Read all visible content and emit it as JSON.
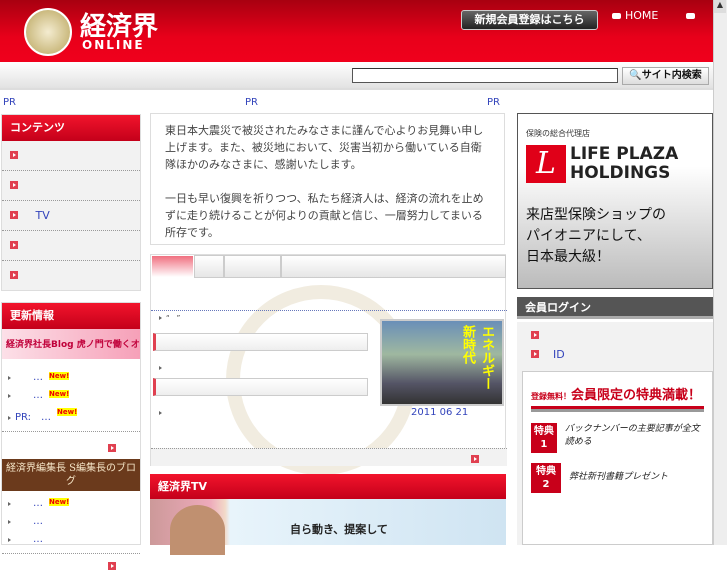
{
  "header": {
    "logo_title": "経済界",
    "logo_sub": "ONLINE",
    "register_button": "新規会員登録はこちら",
    "home_link": "HOME"
  },
  "search": {
    "placeholder": "",
    "button": "サイト内検索"
  },
  "pr_labels": [
    "PR",
    "PR",
    "PR"
  ],
  "sidebar": {
    "contents_title": "コンテンツ",
    "contents_items": [
      "",
      "",
      "TV",
      "",
      ""
    ],
    "updates_title": "更新情報",
    "blog1_banner": "経済界社長Blog 虎ノ門で働くオンナ社長",
    "blog1_items": [
      {
        "label": "…",
        "new": "New!"
      },
      {
        "label": "…",
        "new": "New!"
      },
      {
        "label": "PR:　…",
        "new": "New!"
      }
    ],
    "blog2_banner": "経済界編集長 S編集長のブログ",
    "blog2_items": [
      {
        "label": "…",
        "new": "New!"
      },
      {
        "label": "…"
      },
      {
        "label": "…"
      }
    ]
  },
  "message": {
    "p1": "東日本大震災で被災されたみなさまに謹んで心よりお見舞い申し上げます。また、被災地において、災害当初から働いている自衛隊ほかのみなさまに、感謝いたします。",
    "p2": "一日も早い復興を祈りつつ、私たち経済人は、経済の流れを止めずに走り続けることが何よりの貢献と信じ、一層努力してまいる所存です。"
  },
  "news": {
    "item1": "“　”",
    "cover_title": "エネルギー新時代",
    "cover_date": "2011 06 21"
  },
  "tv": {
    "title": "経済界TV",
    "caption": "自ら動き、提案して"
  },
  "ad": {
    "tagline": "保険の総合代理店",
    "brand1": "LIFE PLAZA",
    "brand2": "HOLDINGS",
    "copy1": "来店型保険ショップの",
    "copy2": "パイオニアにして、",
    "copy3": "日本最大級！"
  },
  "login": {
    "title": "会員ログイン",
    "items": [
      "",
      "ID"
    ]
  },
  "promo": {
    "free": "登録無料！",
    "headline": "会員限定の特典満載！",
    "perks": [
      {
        "badge": "特典",
        "num": "1",
        "text": "バックナンバーの主要記事が全文読める"
      },
      {
        "badge": "特典",
        "num": "2",
        "text": "弊社新刊書籍プレゼント"
      }
    ]
  },
  "colors": {
    "brand_red": "#e8001a",
    "link_blue": "#3344bb"
  }
}
